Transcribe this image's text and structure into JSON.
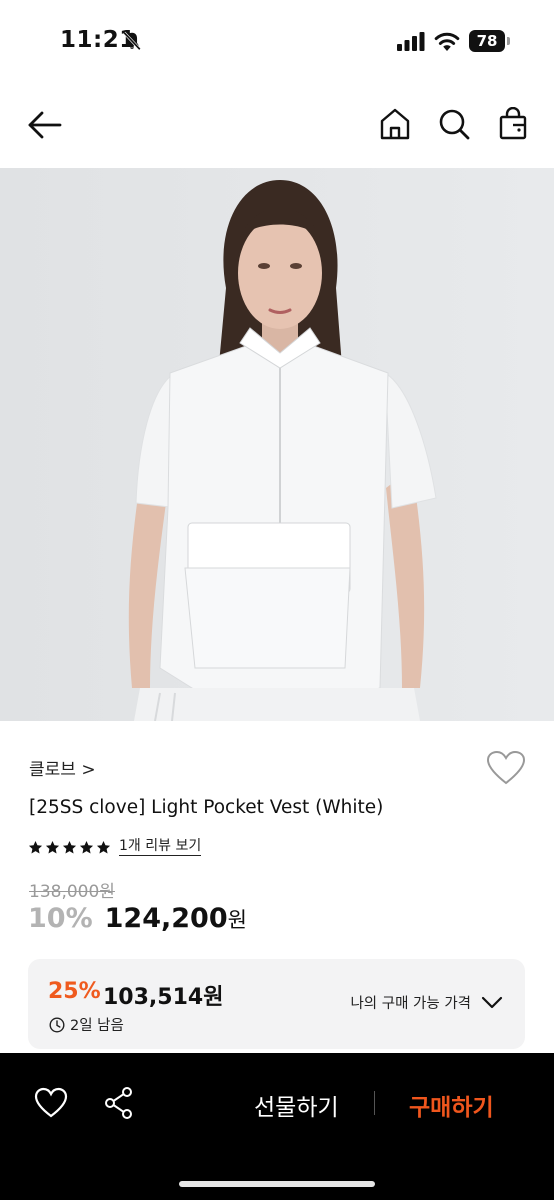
{
  "status_bar": {
    "time": "11:21",
    "battery": "78"
  },
  "header": {
    "back_icon": "arrow-left-icon",
    "home_icon": "home-icon",
    "search_icon": "search-icon",
    "bag_icon": "shopping-bag-icon"
  },
  "product": {
    "image_alt": "white light pocket vest worn by model",
    "brand": "클로브 >",
    "name": "[25SS clove] Light Pocket Vest (White)",
    "rating": 5,
    "review_link": "1개 리뷰 보기",
    "original_price": "138,000원",
    "discount_rate": "10%",
    "sale_price": "124,200",
    "sale_price_unit": "원"
  },
  "my_price": {
    "discount_rate": "25%",
    "price": "103,514원",
    "time_left": "2일 남음",
    "toggle_label": "나의 구매 가능 가격"
  },
  "bottom_bar": {
    "gift_label": "선물하기",
    "buy_label": "구매하기"
  },
  "colors": {
    "accent": "#f0561d",
    "my_price_accent": "#ef5a1e",
    "bottom_bar": "#000000"
  }
}
